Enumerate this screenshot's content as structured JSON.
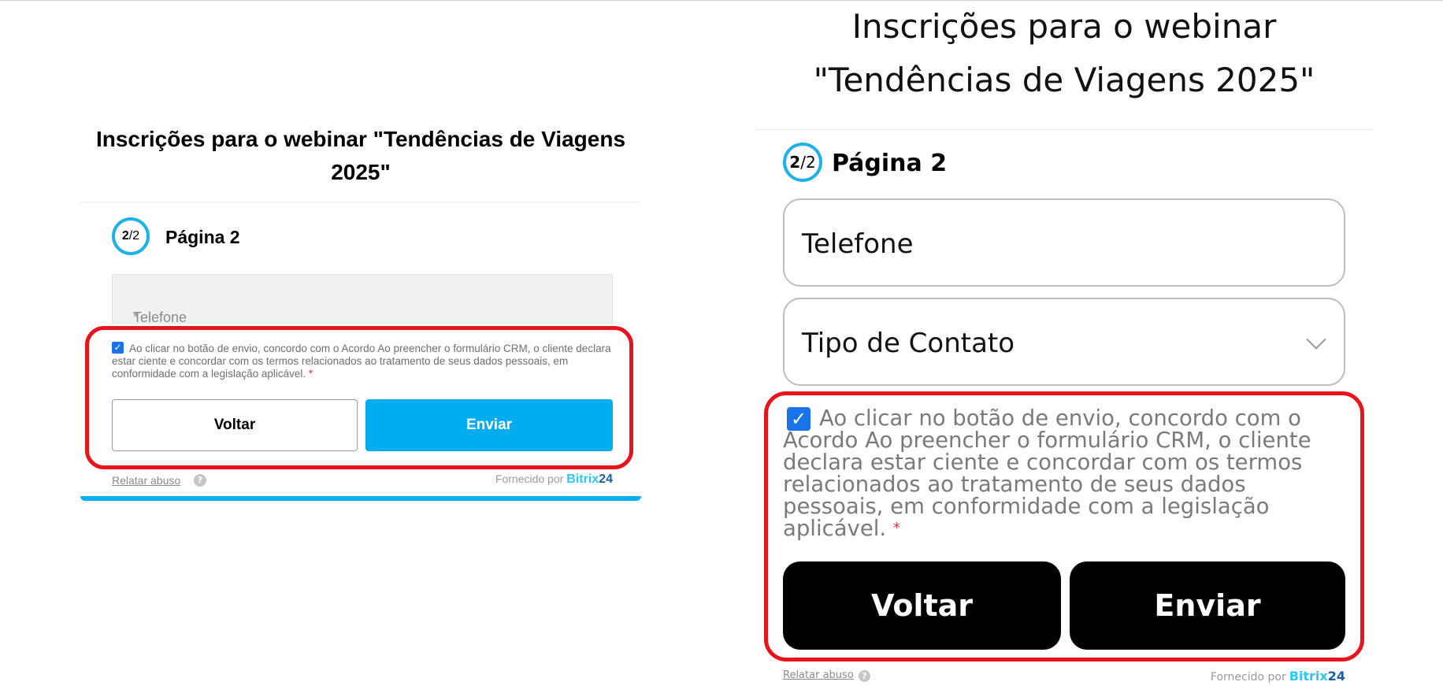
{
  "left_form": {
    "title": "Inscrições para o webinar \"Tendências de Viagens 2025\"",
    "step_current": "2",
    "step_total": "/2",
    "page_label": "Página 2",
    "phone_field": {
      "label": "Telefone",
      "required_mark": "*"
    },
    "consent": {
      "checked": true,
      "text": "Ao clicar no botão de envio, concordo com o Acordo Ao preencher o formulário CRM, o cliente declara estar ciente e concordar com os termos relacionados ao tratamento de seus dados pessoais, em conformidade com a legislação aplicável.",
      "required_mark": "*"
    },
    "back_label": "Voltar",
    "submit_label": "Enviar",
    "report_abuse": "Relatar abuso",
    "help_icon": "?",
    "powered_by": "Fornecido por",
    "brand_name": "Bitrix",
    "brand_number": "24"
  },
  "right_form": {
    "title_line1": "Inscrições para o webinar",
    "title_line2": "\"Tendências de Viagens 2025\"",
    "step_current": "2",
    "step_total": "/2",
    "page_label": "Página 2",
    "phone_field": {
      "label": "Telefone"
    },
    "contact_type_field": {
      "label": "Tipo de Contato"
    },
    "consent": {
      "checked": true,
      "text": "Ao clicar no botão de envio, concordo com o Acordo Ao preencher o formulário CRM, o cliente declara estar ciente e concordar com os termos relacionados ao tratamento de seus dados pessoais, em conformidade com a legislação aplicável.",
      "required_mark": "*"
    },
    "back_label": "Voltar",
    "submit_label": "Enviar",
    "report_abuse": "Relatar abuso",
    "help_icon": "?",
    "powered_by": "Fornecido por",
    "brand_name": "Bitrix",
    "brand_number": "24"
  },
  "colors": {
    "accent": "#00aeef",
    "highlight": "#e8141c",
    "required": "#e5323e",
    "checkbox": "#1a73e8"
  }
}
